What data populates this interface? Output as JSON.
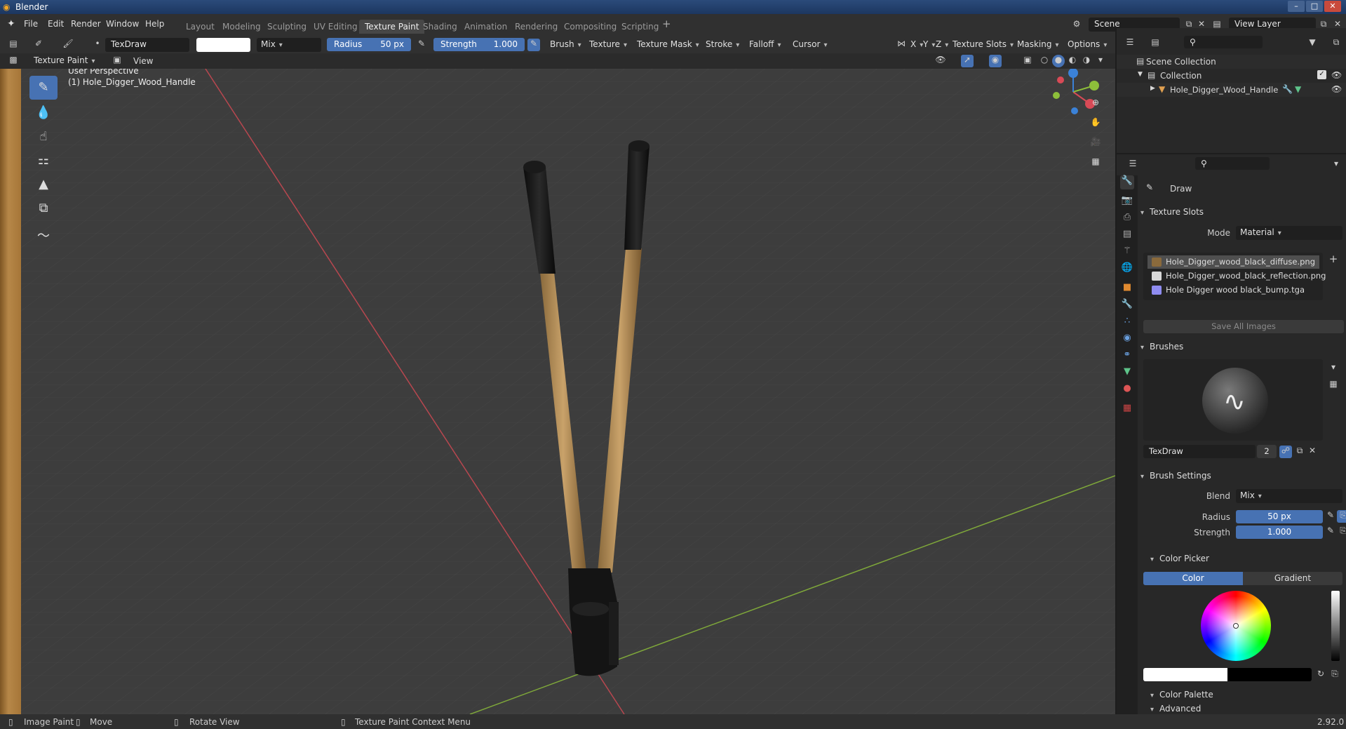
{
  "app": {
    "title": "Blender",
    "version": "2.92.0"
  },
  "menus": [
    "File",
    "Edit",
    "Render",
    "Window",
    "Help"
  ],
  "workspaces": [
    "Layout",
    "Modeling",
    "Sculpting",
    "UV Editing",
    "Texture Paint",
    "Shading",
    "Animation",
    "Rendering",
    "Compositing",
    "Scripting"
  ],
  "active_workspace": "Texture Paint",
  "scene": {
    "name": "Scene",
    "view_layer": "View Layer"
  },
  "toolbar": {
    "brush_name": "TexDraw",
    "blend": "Mix",
    "radius_label": "Radius",
    "radius_value": "50 px",
    "strength_label": "Strength",
    "strength_value": "1.000",
    "menus": [
      "Brush",
      "Texture",
      "Texture Mask",
      "Stroke",
      "Falloff",
      "Cursor"
    ],
    "axes": [
      "X",
      "Y",
      "Z"
    ],
    "right_menus": [
      "Texture Slots",
      "Masking",
      "Options"
    ]
  },
  "view_header": {
    "mode": "Texture Paint",
    "view": "View"
  },
  "viewport": {
    "perspective": "User Perspective",
    "object": "(1) Hole_Digger_Wood_Handle",
    "gizmo": {
      "x": "X",
      "y": "Y",
      "z": "Z"
    }
  },
  "outliner": {
    "root": "Scene Collection",
    "collection": "Collection",
    "object": "Hole_Digger_Wood_Handle"
  },
  "properties": {
    "tool_name": "Draw",
    "texture_slots": {
      "title": "Texture Slots",
      "mode_label": "Mode",
      "mode_value": "Material",
      "slots": [
        {
          "name": "Hole_Digger_wood_black_diffuse.png",
          "color": "#8a6a3c"
        },
        {
          "name": "Hole_Digger_wood_black_reflection.png",
          "color": "#d8d8d8"
        },
        {
          "name": "Hole Digger wood black_bump.tga",
          "color": "#8f8cf0"
        }
      ],
      "save_button": "Save All Images"
    },
    "brushes": {
      "title": "Brushes",
      "name": "TexDraw",
      "users": "2"
    },
    "brush_settings": {
      "title": "Brush Settings",
      "blend_label": "Blend",
      "blend_value": "Mix",
      "radius_label": "Radius",
      "radius_value": "50 px",
      "strength_label": "Strength",
      "strength_value": "1.000"
    },
    "color_picker": {
      "title": "Color Picker",
      "tab_color": "Color",
      "tab_gradient": "Gradient"
    },
    "color_palette": "Color Palette",
    "advanced": "Advanced"
  },
  "statusbar": {
    "left_action": "Image Paint",
    "move": "Move",
    "rotate": "Rotate View",
    "context": "Texture Paint Context Menu"
  },
  "colors": {
    "accent": "#4772b3",
    "header": "#303030",
    "panel": "#282828",
    "viewport": "#3d3d3d",
    "x_axis": "#d84a56",
    "y_axis": "#8dbf3a",
    "z_axis": "#3b82d8"
  }
}
